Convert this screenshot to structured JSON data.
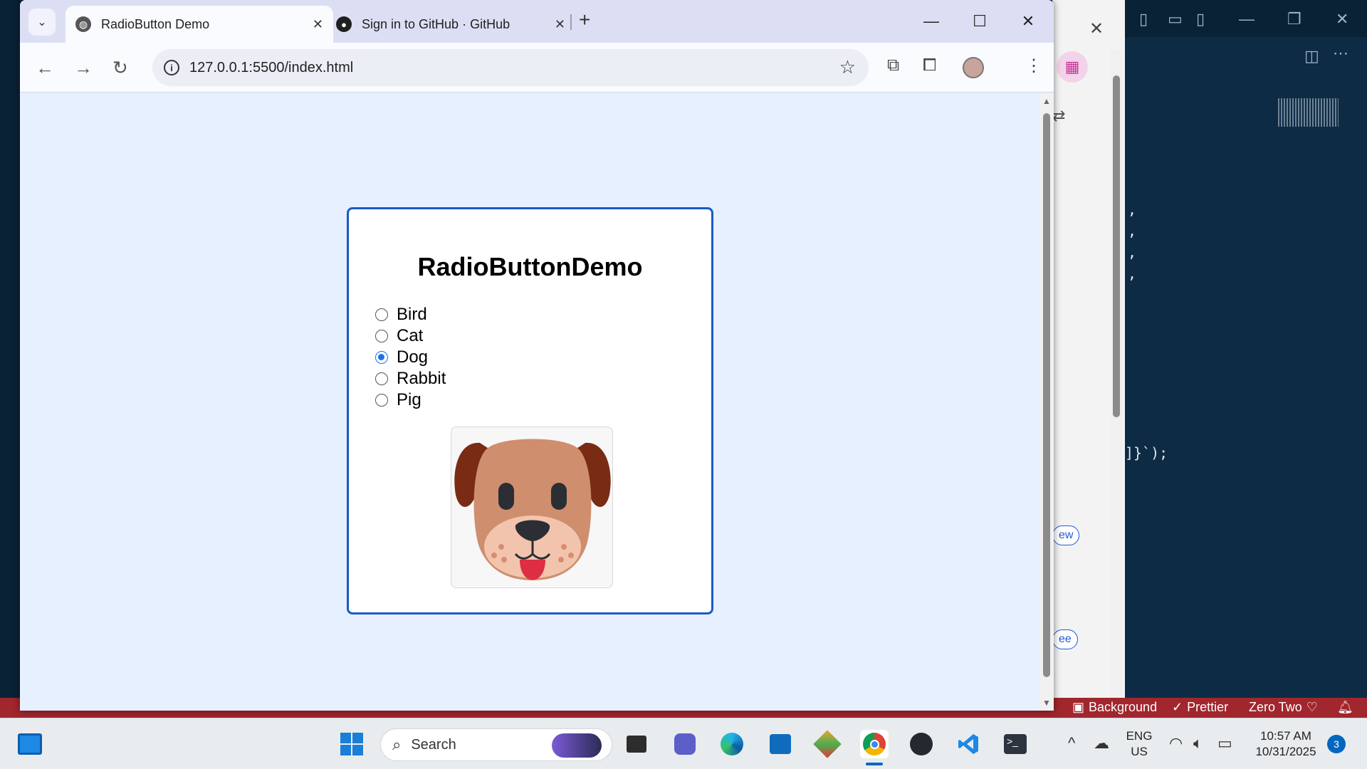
{
  "browser": {
    "tabs": [
      {
        "title": "RadioButton Demo",
        "active": true
      },
      {
        "title": "Sign in to GitHub · GitHub",
        "active": false
      }
    ],
    "url": "127.0.0.1:5500/index.html"
  },
  "page": {
    "title": "RadioButtonDemo",
    "options": [
      {
        "label": "Bird",
        "checked": false
      },
      {
        "label": "Cat",
        "checked": false
      },
      {
        "label": "Dog",
        "checked": true
      },
      {
        "label": "Rabbit",
        "checked": false
      },
      {
        "label": "Pig",
        "checked": false
      }
    ],
    "image_icon": "dog-face-icon"
  },
  "side_panel": {
    "pill_1": "ew",
    "pill_2": "ee"
  },
  "vscode": {
    "code_fragment": "]}`);",
    "status": {
      "background": "Background",
      "prettier": "Prettier",
      "theme": "Zero Two"
    }
  },
  "taskbar": {
    "search_placeholder": "Search",
    "lang_top": "ENG",
    "lang_bottom": "US",
    "time": "10:57 AM",
    "date": "10/31/2025",
    "notifications": "3"
  },
  "colors": {
    "accent": "#1a5bc4",
    "radio_checked": "#1a73e8",
    "page_bg": "#e6f0ff",
    "status_bar": "#a1262d"
  }
}
